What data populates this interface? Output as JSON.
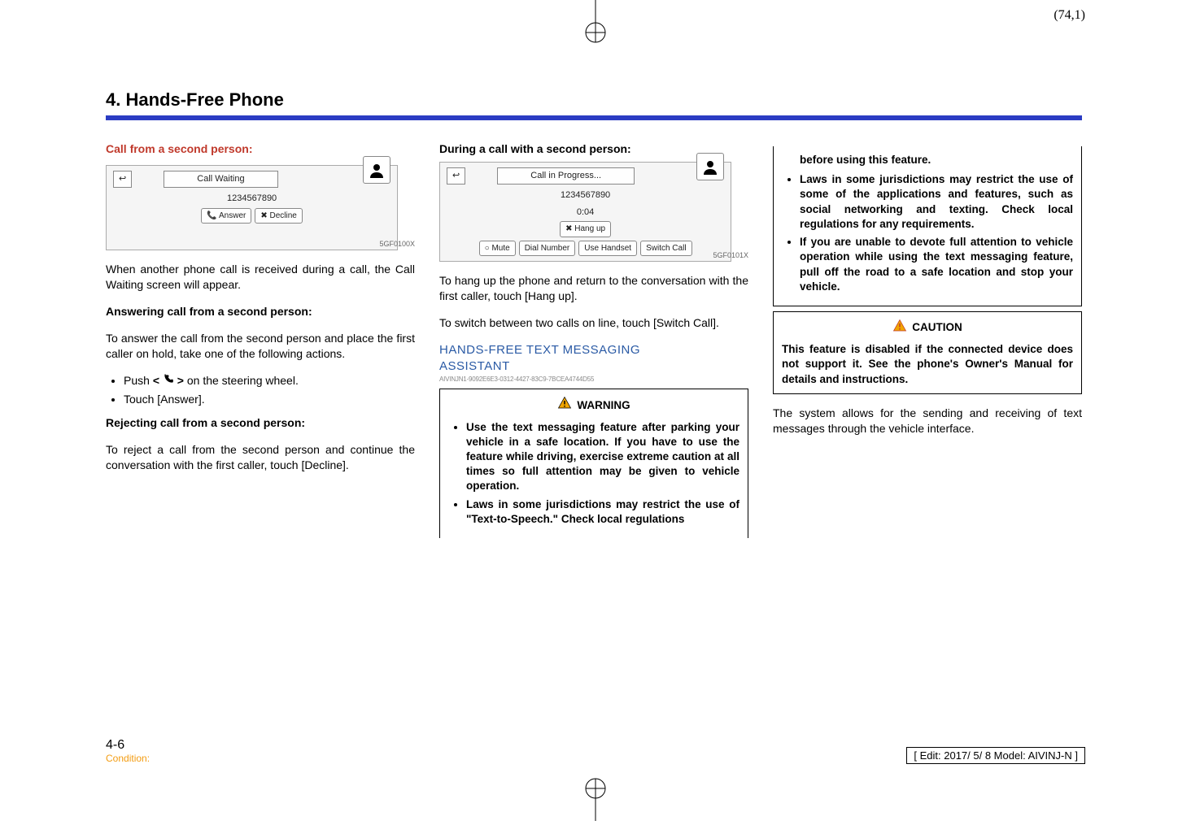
{
  "page_annotation": "(74,1)",
  "chapter": "4. Hands-Free Phone",
  "col1": {
    "red_heading": "Call from a second person:",
    "fig_title": "Call Waiting",
    "fig_number": "1234567890",
    "fig_btn_answer": "Answer",
    "fig_btn_decline": "Decline",
    "fig_code": "5GF0100X",
    "p1": "When another phone call is received during a call, the Call Waiting screen will appear.",
    "h_answer": "Answering call from a second person:",
    "p2": "To answer the call from the second person and place the first caller on hold, take one of the following actions.",
    "li1_a": "Push ",
    "li1_b": " on the steering wheel.",
    "li2": "Touch [Answer].",
    "h_reject": "Rejecting call from a second person:",
    "p3": "To reject a call from the second person and continue the conversation with the first caller, touch [Decline]."
  },
  "col2": {
    "bold_heading": "During a call with a second person:",
    "fig_title": "Call in Progress...",
    "fig_number": "1234567890",
    "fig_timer": "0:04",
    "fig_hang": "Hang up",
    "fig_mute": "Mute",
    "fig_dial": "Dial Number",
    "fig_handset": "Use Handset",
    "fig_switch": "Switch Call",
    "fig_code": "5GF0101X",
    "p1": "To hang up the phone and return to the conversation with the first caller, touch [Hang up].",
    "p2": "To switch between two calls on line, touch [Switch Call].",
    "blue_h1": "HANDS-FREE TEXT MESSAGING",
    "blue_h2": "ASSISTANT",
    "guid": "AIVINJN1-9092E6E3-0312-4427-83C9-7BCEA4744D55",
    "warn_title": "WARNING",
    "w1": "Use the text messaging feature after parking your vehicle in a safe location. If you have to use the feature while driving, exercise extreme caution at all times so full attention may be given to vehicle operation.",
    "w2": "Laws in some jurisdictions may restrict the use of \"Text-to-Speech.\" Check local regulations"
  },
  "col3": {
    "cont": "before using this feature.",
    "w3": "Laws in some jurisdictions may restrict the use of some of the applications and features, such as social networking and texting. Check local regulations for any requirements.",
    "w4": "If you are unable to devote full attention to vehicle operation while using the text messaging feature, pull off the road to a safe location and stop your vehicle.",
    "caution_title": "CAUTION",
    "caution_body": "This feature is disabled if the connected device does not support it. See the phone's Owner's Manual for details and instructions.",
    "p_after": "The system allows for the sending and receiving of text messages through the vehicle interface."
  },
  "footer": {
    "pageno": "4-6",
    "condition": "Condition:",
    "editbox": "[ Edit: 2017/ 5/ 8    Model:  AIVINJ-N ]"
  }
}
